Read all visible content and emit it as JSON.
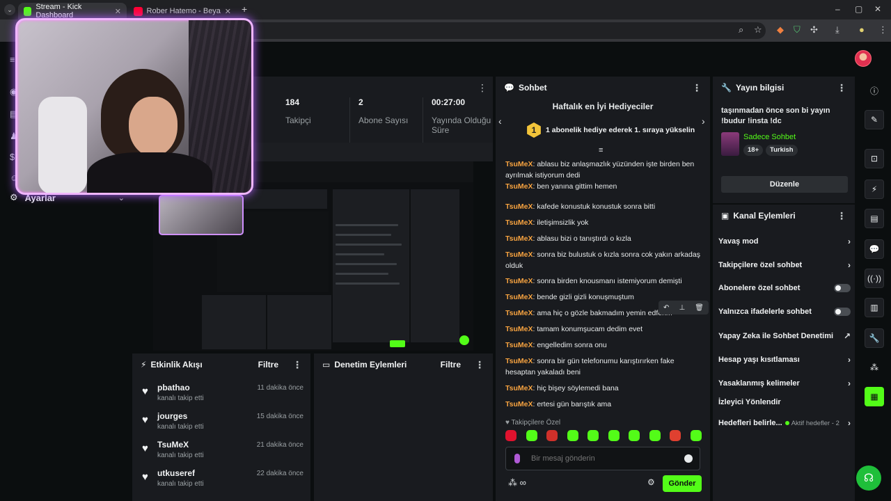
{
  "browser": {
    "tabs": [
      {
        "title": "Stream - Kick Dashboard",
        "color": "#53fc18"
      },
      {
        "title": "Rober Hatemo - Beyaz Ve Sen",
        "color": "#ff0033"
      }
    ],
    "new_tab": "+",
    "window_controls": [
      "–",
      "▢",
      "✕"
    ]
  },
  "nav": {
    "settings_label": "Ayarlar"
  },
  "stats": {
    "followers": {
      "value": "184",
      "label": "Takipçi"
    },
    "subscribers": {
      "value": "2",
      "label": "Abone Sayısı"
    },
    "time_live": {
      "value": "00:27:00",
      "label": "Yayında Olduğu Süre"
    }
  },
  "activity": {
    "title": "Etkinlik Akışı",
    "filter": "Filtre",
    "items": [
      {
        "name": "pbathao",
        "action": "kanalı takip etti",
        "time": "11 dakika önce"
      },
      {
        "name": "jourges",
        "action": "kanalı takip etti",
        "time": "15 dakika önce"
      },
      {
        "name": "TsuMeX",
        "action": "kanalı takip etti",
        "time": "21 dakika önce"
      },
      {
        "name": "utkuseref",
        "action": "kanalı takip etti",
        "time": "22 dakika önce"
      }
    ]
  },
  "moderation": {
    "title": "Denetim Eylemleri",
    "filter": "Filtre"
  },
  "chat": {
    "title": "Sohbet",
    "gifters_title": "Haftalık en İyi Hediyeciler",
    "gifters_rank": "1",
    "gifters_text": "1 abonelik hediye ederek 1. sıraya yükselin",
    "messages": [
      {
        "user": "TsuMeX",
        "text": "ablasu biz anlaşmazlık yüzünden işte birden ben ayrılmak istiyorum dedi"
      },
      {
        "user": "TsuMeX",
        "text": "ben yanına gittim hemen"
      },
      {
        "user": "TsuMeX",
        "text": "kafede konustuk konustuk sonra bitti"
      },
      {
        "user": "TsuMeX",
        "text": "iletişimsizlik yok"
      },
      {
        "user": "TsuMeX",
        "text": "ablasu bizi o tanıştırdı o kızla"
      },
      {
        "user": "TsuMeX",
        "text": "sonra biz bulustuk o kızla sonra cok yakın arkadaş olduk"
      },
      {
        "user": "TsuMeX",
        "text": "sonra birden knousmanı istemiyorum demişti"
      },
      {
        "user": "TsuMeX",
        "text": "bende gizli gizli konuşmuştum"
      },
      {
        "user": "TsuMeX",
        "text": "ama hiç o gözle bakmadım yemin edferim"
      },
      {
        "user": "TsuMeX",
        "text": "tamam konumşucam dedim evet"
      },
      {
        "user": "TsuMeX",
        "text": "engelledim sonra onu"
      },
      {
        "user": "TsuMeX",
        "text": "sonra bir gün telefonumu karıştırırken fake hesaptan yakaladı beni"
      },
      {
        "user": "TsuMeX",
        "text": "hiç bişey söylemedi bana"
      },
      {
        "user": "TsuMeX",
        "text": "ertesi gün barıştık ama"
      }
    ],
    "followers_only": "Takipçilere Özel",
    "input_placeholder": "Bir mesaj gönderin",
    "send_label": "Gönder"
  },
  "stream_info": {
    "title": "Yayın bilgisi",
    "stream_title": "taşınmadan önce son bi yayın !budur !insta !dc",
    "category": "Sadece Sohbet",
    "tags": [
      "18+",
      "Turkish"
    ],
    "edit_label": "Düzenle"
  },
  "channel_actions": {
    "title": "Kanal Eylemleri",
    "items": [
      {
        "label": "Yavaş mod",
        "control": "chevron"
      },
      {
        "label": "Takipçilere özel sohbet",
        "control": "chevron"
      },
      {
        "label": "Abonelere özel sohbet",
        "control": "toggle"
      },
      {
        "label": "Yalnızca ifadelerle sohbet",
        "control": "toggle"
      },
      {
        "label": "Yapay Zeka ile Sohbet Denetimi",
        "control": "external"
      },
      {
        "label": "Hesap yaşı kısıtlaması",
        "control": "chevron"
      },
      {
        "label": "Yasaklanmış kelimeler",
        "control": "chevron"
      },
      {
        "label": "İzleyici Yönlendir",
        "control": "none"
      }
    ],
    "goals_label": "Hedefleri belirle...",
    "goals_status": "Aktif hedefler - 2"
  },
  "colors": {
    "accent": "#53fc18",
    "username": "#f7a340",
    "panel": "#191b1f",
    "background": "#0b0e0f"
  }
}
